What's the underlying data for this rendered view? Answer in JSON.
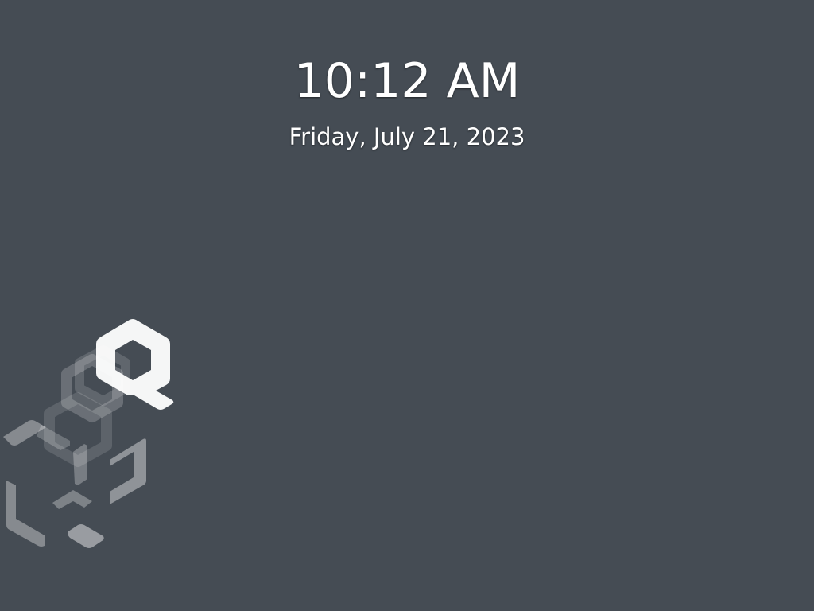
{
  "lock_screen": {
    "time": "10:12 AM",
    "date": "Friday, July 21, 2023"
  },
  "colors": {
    "background": "#454c54",
    "text": "#ffffff"
  },
  "logo": {
    "icon": "qubes-logo-icon"
  }
}
